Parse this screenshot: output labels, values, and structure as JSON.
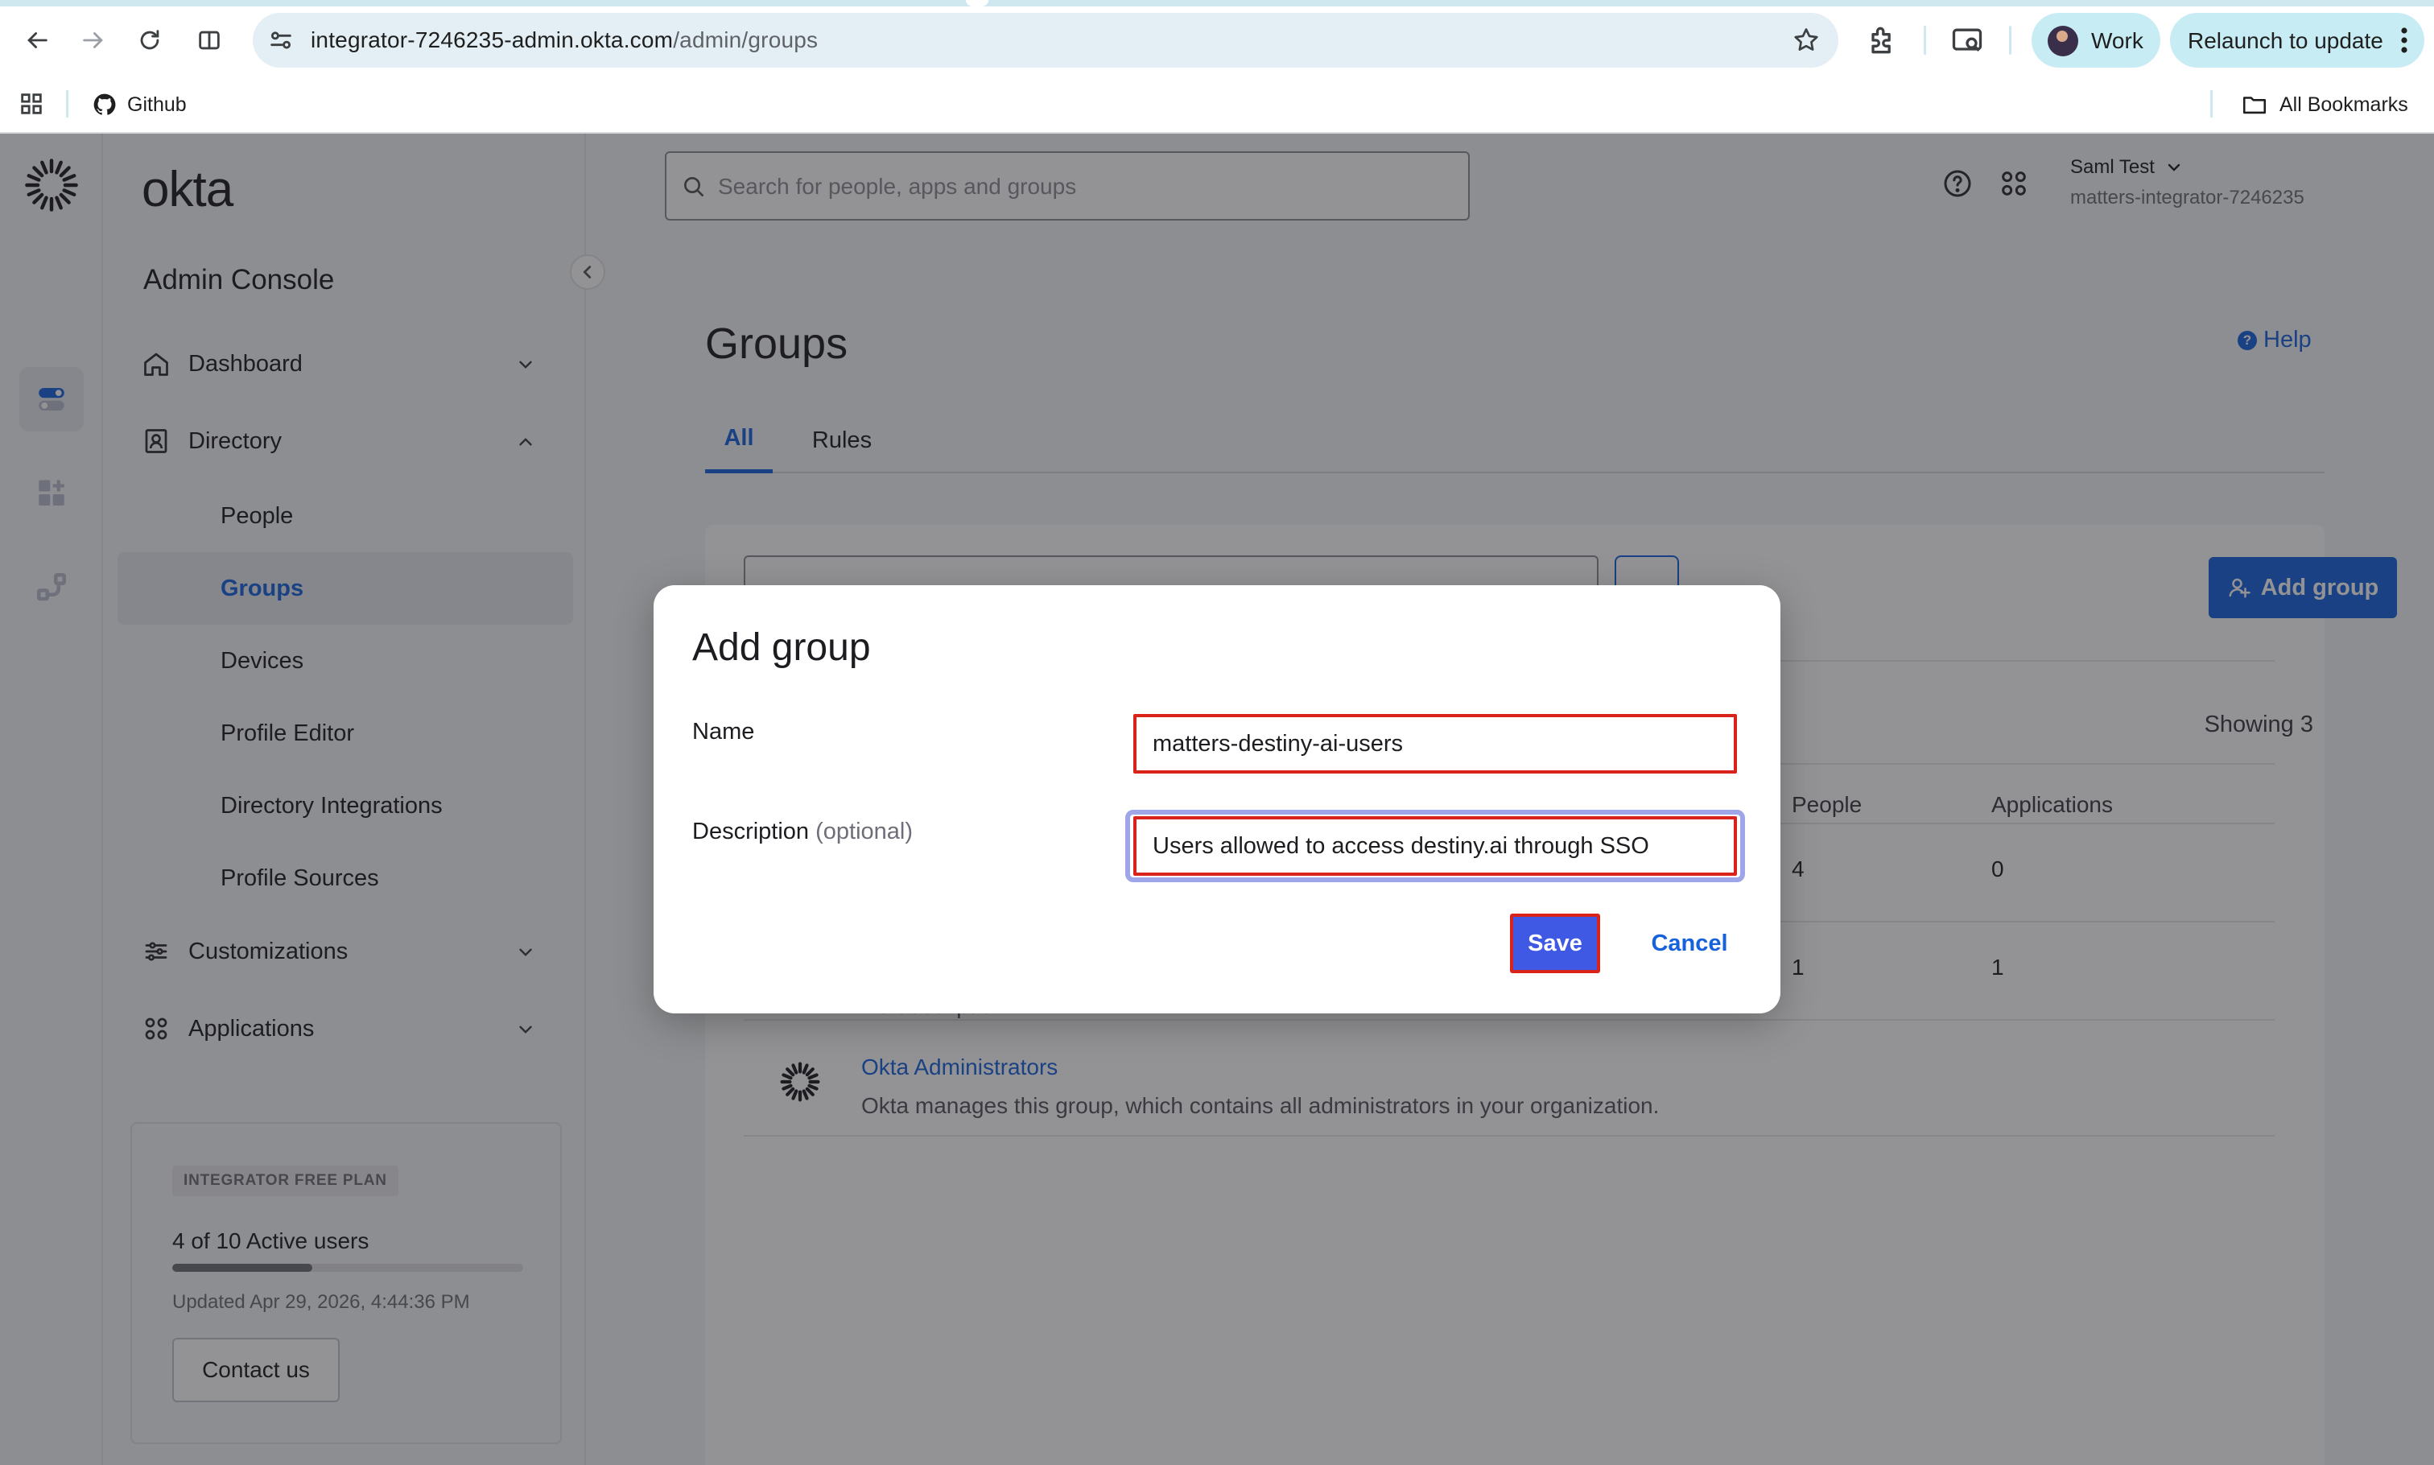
{
  "browser": {
    "url_host": "integrator-7246235-admin.okta.com",
    "url_path": "/admin/groups",
    "profile_label": "Work",
    "relaunch_label": "Relaunch to update",
    "bookmarks": [
      {
        "label": "Github",
        "icon": "github-icon"
      }
    ],
    "all_bookmarks_label": "All Bookmarks"
  },
  "app": {
    "logo": "okta",
    "console_title": "Admin Console",
    "search_placeholder": "Search for people, apps and groups",
    "user_name": "Saml Test",
    "user_org": "matters-integrator-7246235",
    "nav": {
      "dashboard": "Dashboard",
      "directory": "Directory",
      "directory_items": [
        "People",
        "Groups",
        "Devices",
        "Profile Editor",
        "Directory Integrations",
        "Profile Sources"
      ],
      "active_item": "Groups",
      "customizations": "Customizations",
      "applications": "Applications"
    },
    "plan": {
      "badge": "INTEGRATOR FREE PLAN",
      "users_text": "4 of 10 Active users",
      "users_fraction": 0.4,
      "updated": "Updated Apr 29, 2026, 4:44:36 PM",
      "contact_label": "Contact us"
    }
  },
  "page": {
    "title": "Groups",
    "help_label": "Help",
    "tabs": [
      "All",
      "Rules"
    ],
    "active_tab": "All",
    "add_group_label": "Add group",
    "showing_text": "Showing 3",
    "columns": {
      "people": "People",
      "applications": "Applications"
    },
    "rows": [
      {
        "people": "4",
        "applications": "0"
      },
      {
        "desc": "No description",
        "people": "1",
        "applications": "1"
      },
      {
        "name": "Okta Administrators",
        "desc": "Okta manages this group, which contains all administrators in your organization."
      }
    ]
  },
  "modal": {
    "title": "Add group",
    "name_label": "Name",
    "name_value": "matters-destiny-ai-users",
    "description_label": "Description",
    "description_optional": "(optional)",
    "description_value": "Users allowed to access destiny.ai through SSO",
    "save_label": "Save",
    "cancel_label": "Cancel"
  },
  "colors": {
    "accent": "#1662dd",
    "save": "#3f59e4",
    "highlight": "#d9221a"
  }
}
